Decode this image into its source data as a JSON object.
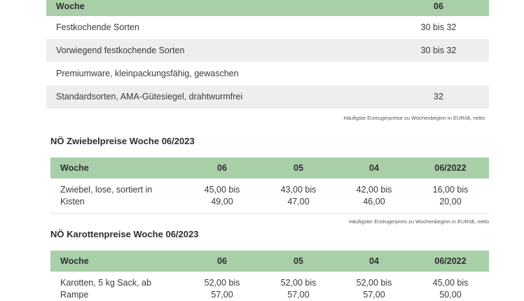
{
  "table1": {
    "header": {
      "label": "Woche",
      "col": "06"
    },
    "rows": [
      {
        "label": "Festkochende Sorten",
        "value": "30 bis 32"
      },
      {
        "label": "Vorwiegend festkochende Sorten",
        "value": "30 bis 32"
      },
      {
        "label": "Premiumware, kleinpackungsfähig, gewaschen",
        "value": ""
      },
      {
        "label": "Standardsorten, AMA-Gütesiegel, drahtwurmfrei",
        "value": "32"
      }
    ],
    "note": "Häufigste Erzeugerpreise zu Wochenbeginn in EUR/dt, netto"
  },
  "table2": {
    "title": "NÖ Zwiebelpreise Woche 06/2023",
    "headers": [
      "Woche",
      "06",
      "05",
      "04",
      "06/2022"
    ],
    "row": {
      "label": [
        "Zwiebel, lose, sortiert in",
        "Kisten"
      ],
      "values": [
        [
          "45,00 bis",
          "49,00"
        ],
        [
          "43,00 bis",
          "47,00"
        ],
        [
          "42,00 bis",
          "46,00"
        ],
        [
          "16,00 bis",
          "20,00"
        ]
      ]
    },
    "note": "Häufigster Erzeugerpreis zu Wochenbeginn in EUR/dt, netto"
  },
  "table3": {
    "title": "NÖ Karottenpreise Woche 06/2023",
    "headers": [
      "Woche",
      "06",
      "05",
      "04",
      "06/2022"
    ],
    "row": {
      "label": [
        "Karotten, 5 kg Sack, ab",
        "Rampe"
      ],
      "values": [
        [
          "52,00 bis",
          "57,00"
        ],
        [
          "52,00 bis",
          "57,00"
        ],
        [
          "52,00 bis",
          "57,00"
        ],
        [
          "45,00 bis",
          "50,00"
        ]
      ]
    }
  }
}
